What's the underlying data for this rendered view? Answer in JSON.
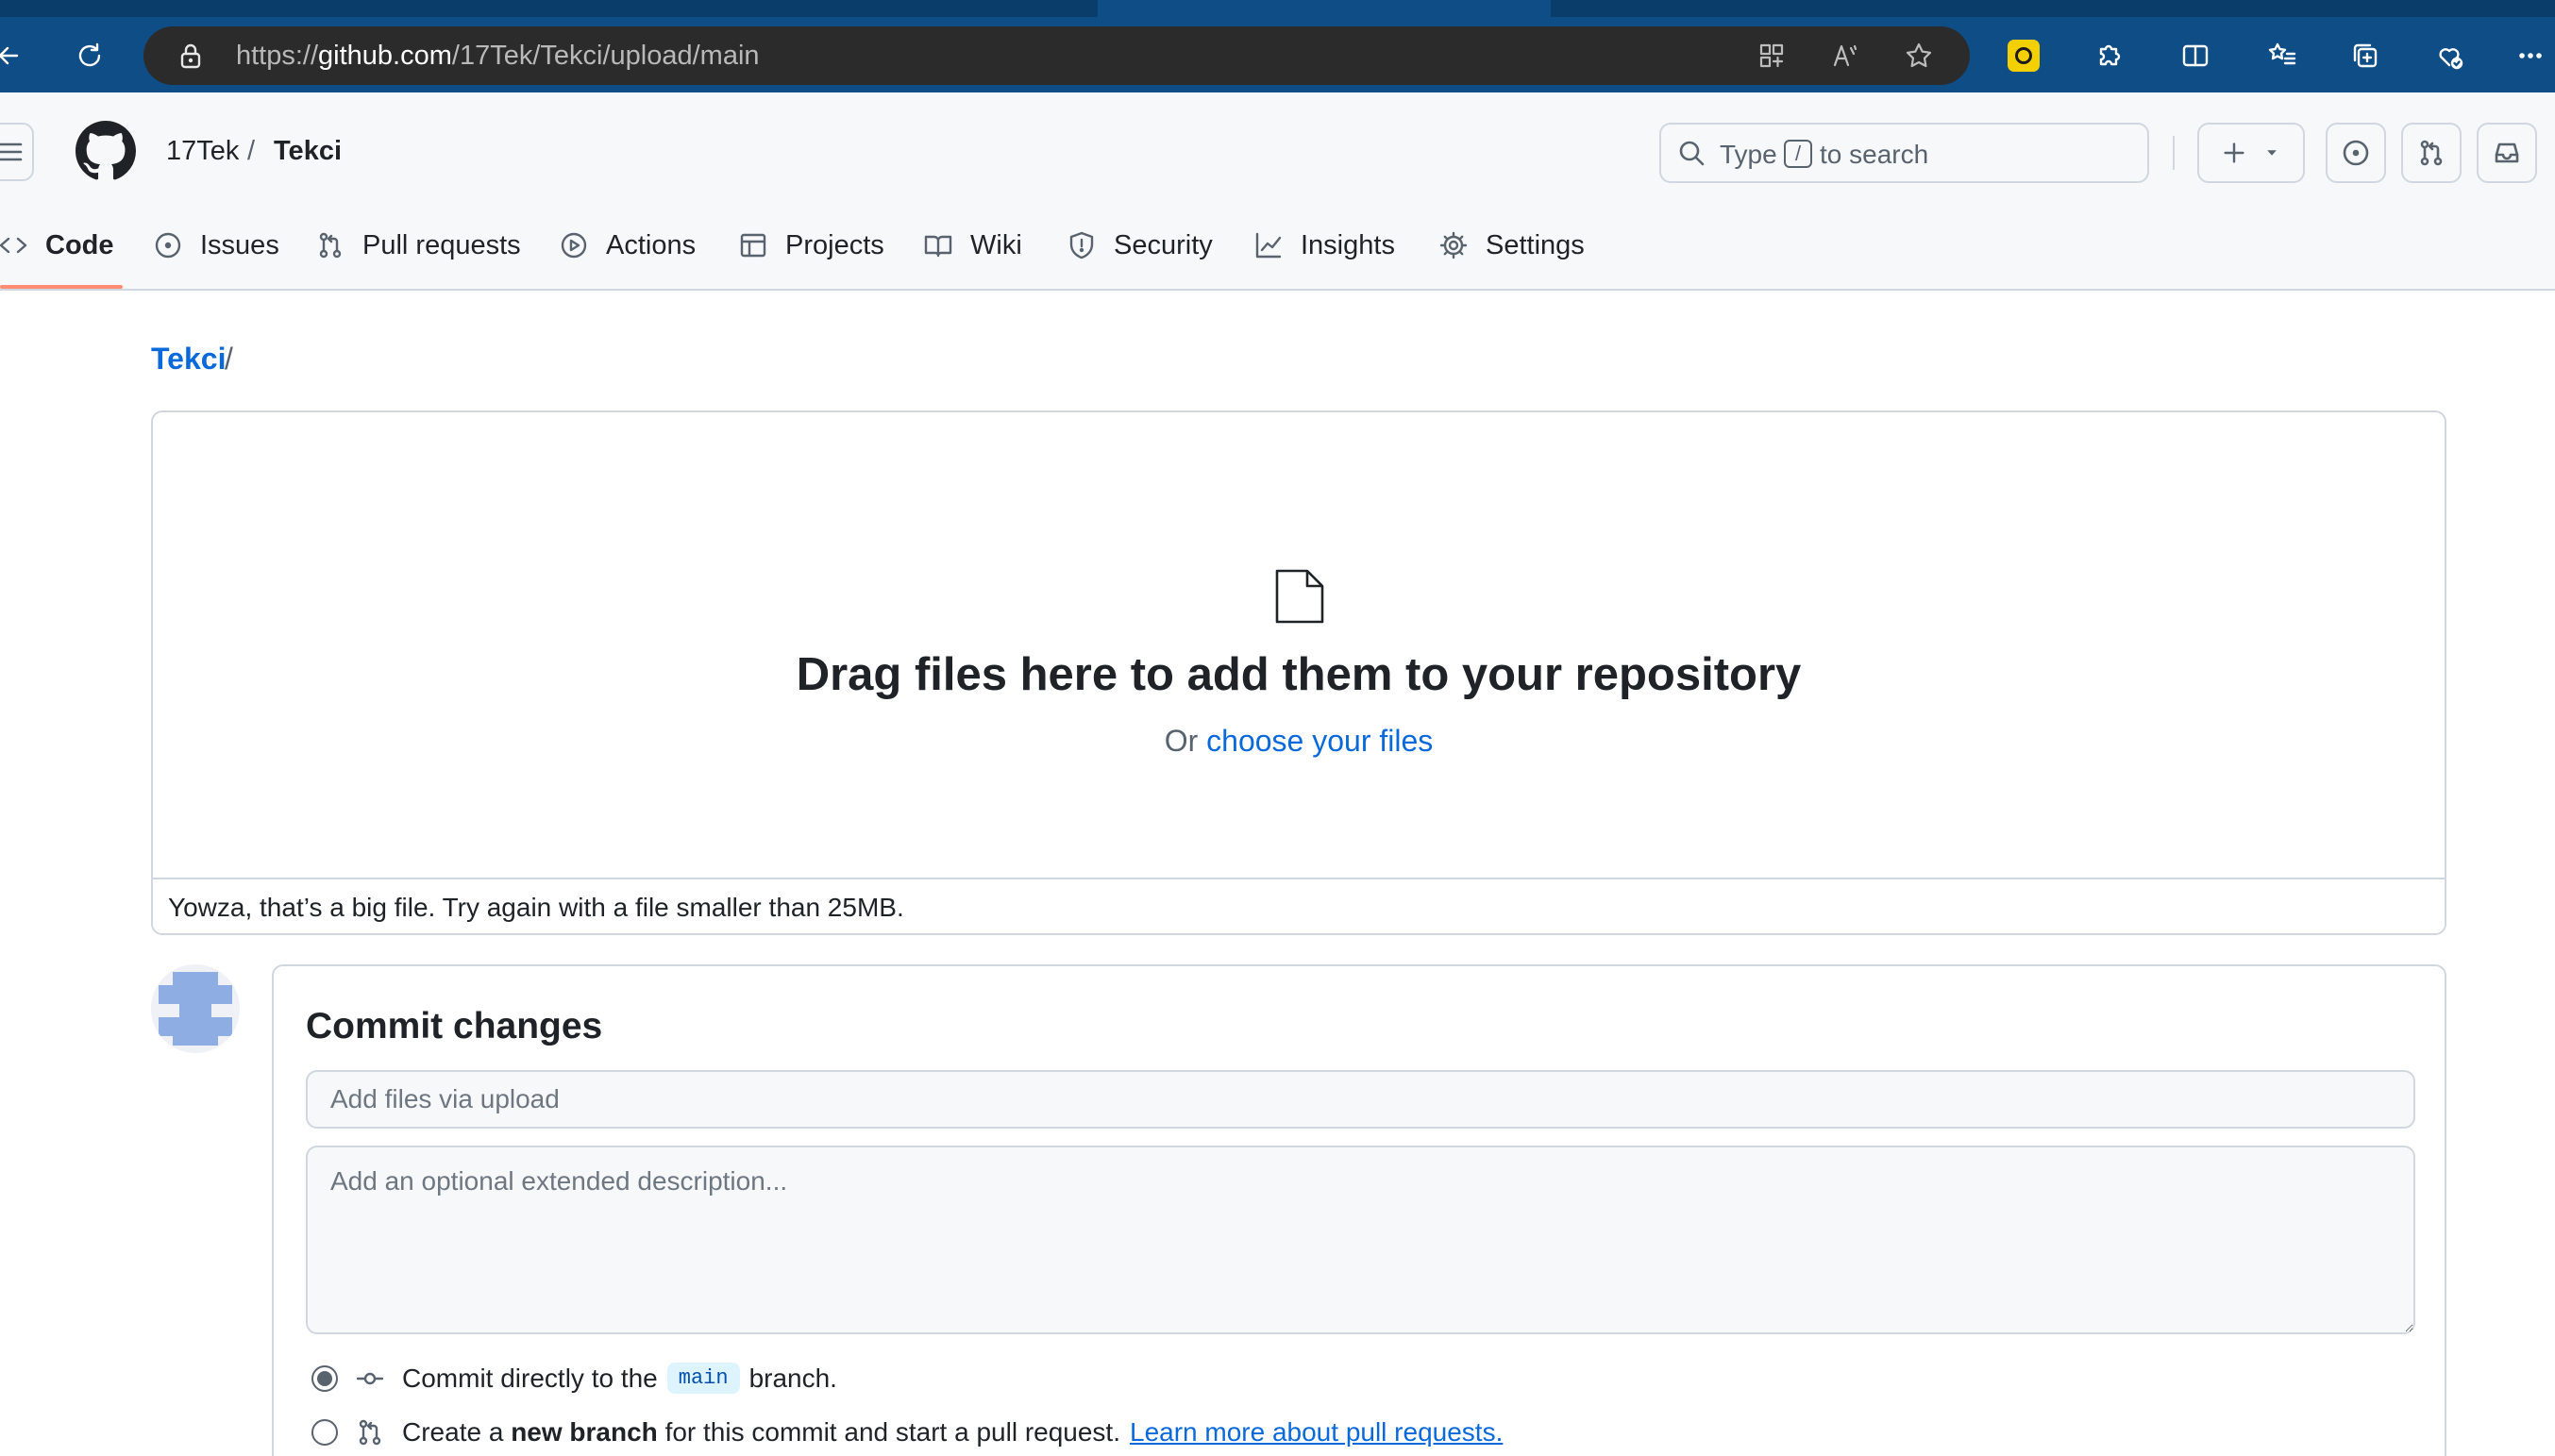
{
  "browser": {
    "url_scheme": "https://",
    "url_host": "github.com",
    "url_path": "/17Tek/Tekci/upload/main"
  },
  "header": {
    "owner": "17Tek",
    "separator": "/",
    "repo": "Tekci",
    "search": {
      "prefix": "Type",
      "key": "/",
      "suffix": "to search"
    }
  },
  "nav": {
    "items": [
      {
        "label": "Code",
        "icon": "code-icon",
        "active": true
      },
      {
        "label": "Issues",
        "icon": "issue-opened-icon"
      },
      {
        "label": "Pull requests",
        "icon": "git-pull-request-icon"
      },
      {
        "label": "Actions",
        "icon": "play-icon"
      },
      {
        "label": "Projects",
        "icon": "table-icon"
      },
      {
        "label": "Wiki",
        "icon": "book-icon"
      },
      {
        "label": "Security",
        "icon": "shield-icon"
      },
      {
        "label": "Insights",
        "icon": "graph-icon"
      },
      {
        "label": "Settings",
        "icon": "gear-icon"
      }
    ]
  },
  "breadcrumb": {
    "repo": "Tekci",
    "separator": "/"
  },
  "upload": {
    "title": "Drag files here to add them to your repository",
    "or_text": "Or",
    "choose_link": "choose your files",
    "error": "Yowza, that’s a big file. Try again with a file smaller than 25MB."
  },
  "commit": {
    "title": "Commit changes",
    "summary_placeholder": "Add files via upload",
    "description_placeholder": "Add an optional extended description...",
    "option_direct": {
      "before": "Commit directly to the",
      "branch": "main",
      "after": "branch."
    },
    "option_new_branch": {
      "before": "Create a",
      "bold": "new branch",
      "after": "for this commit and start a pull request.",
      "link": "Learn more about pull requests."
    }
  },
  "colors": {
    "browser_bar": "#0f4d86",
    "link": "#0969da",
    "active_tab_underline": "#fd8c73",
    "border": "#d0d7de"
  }
}
